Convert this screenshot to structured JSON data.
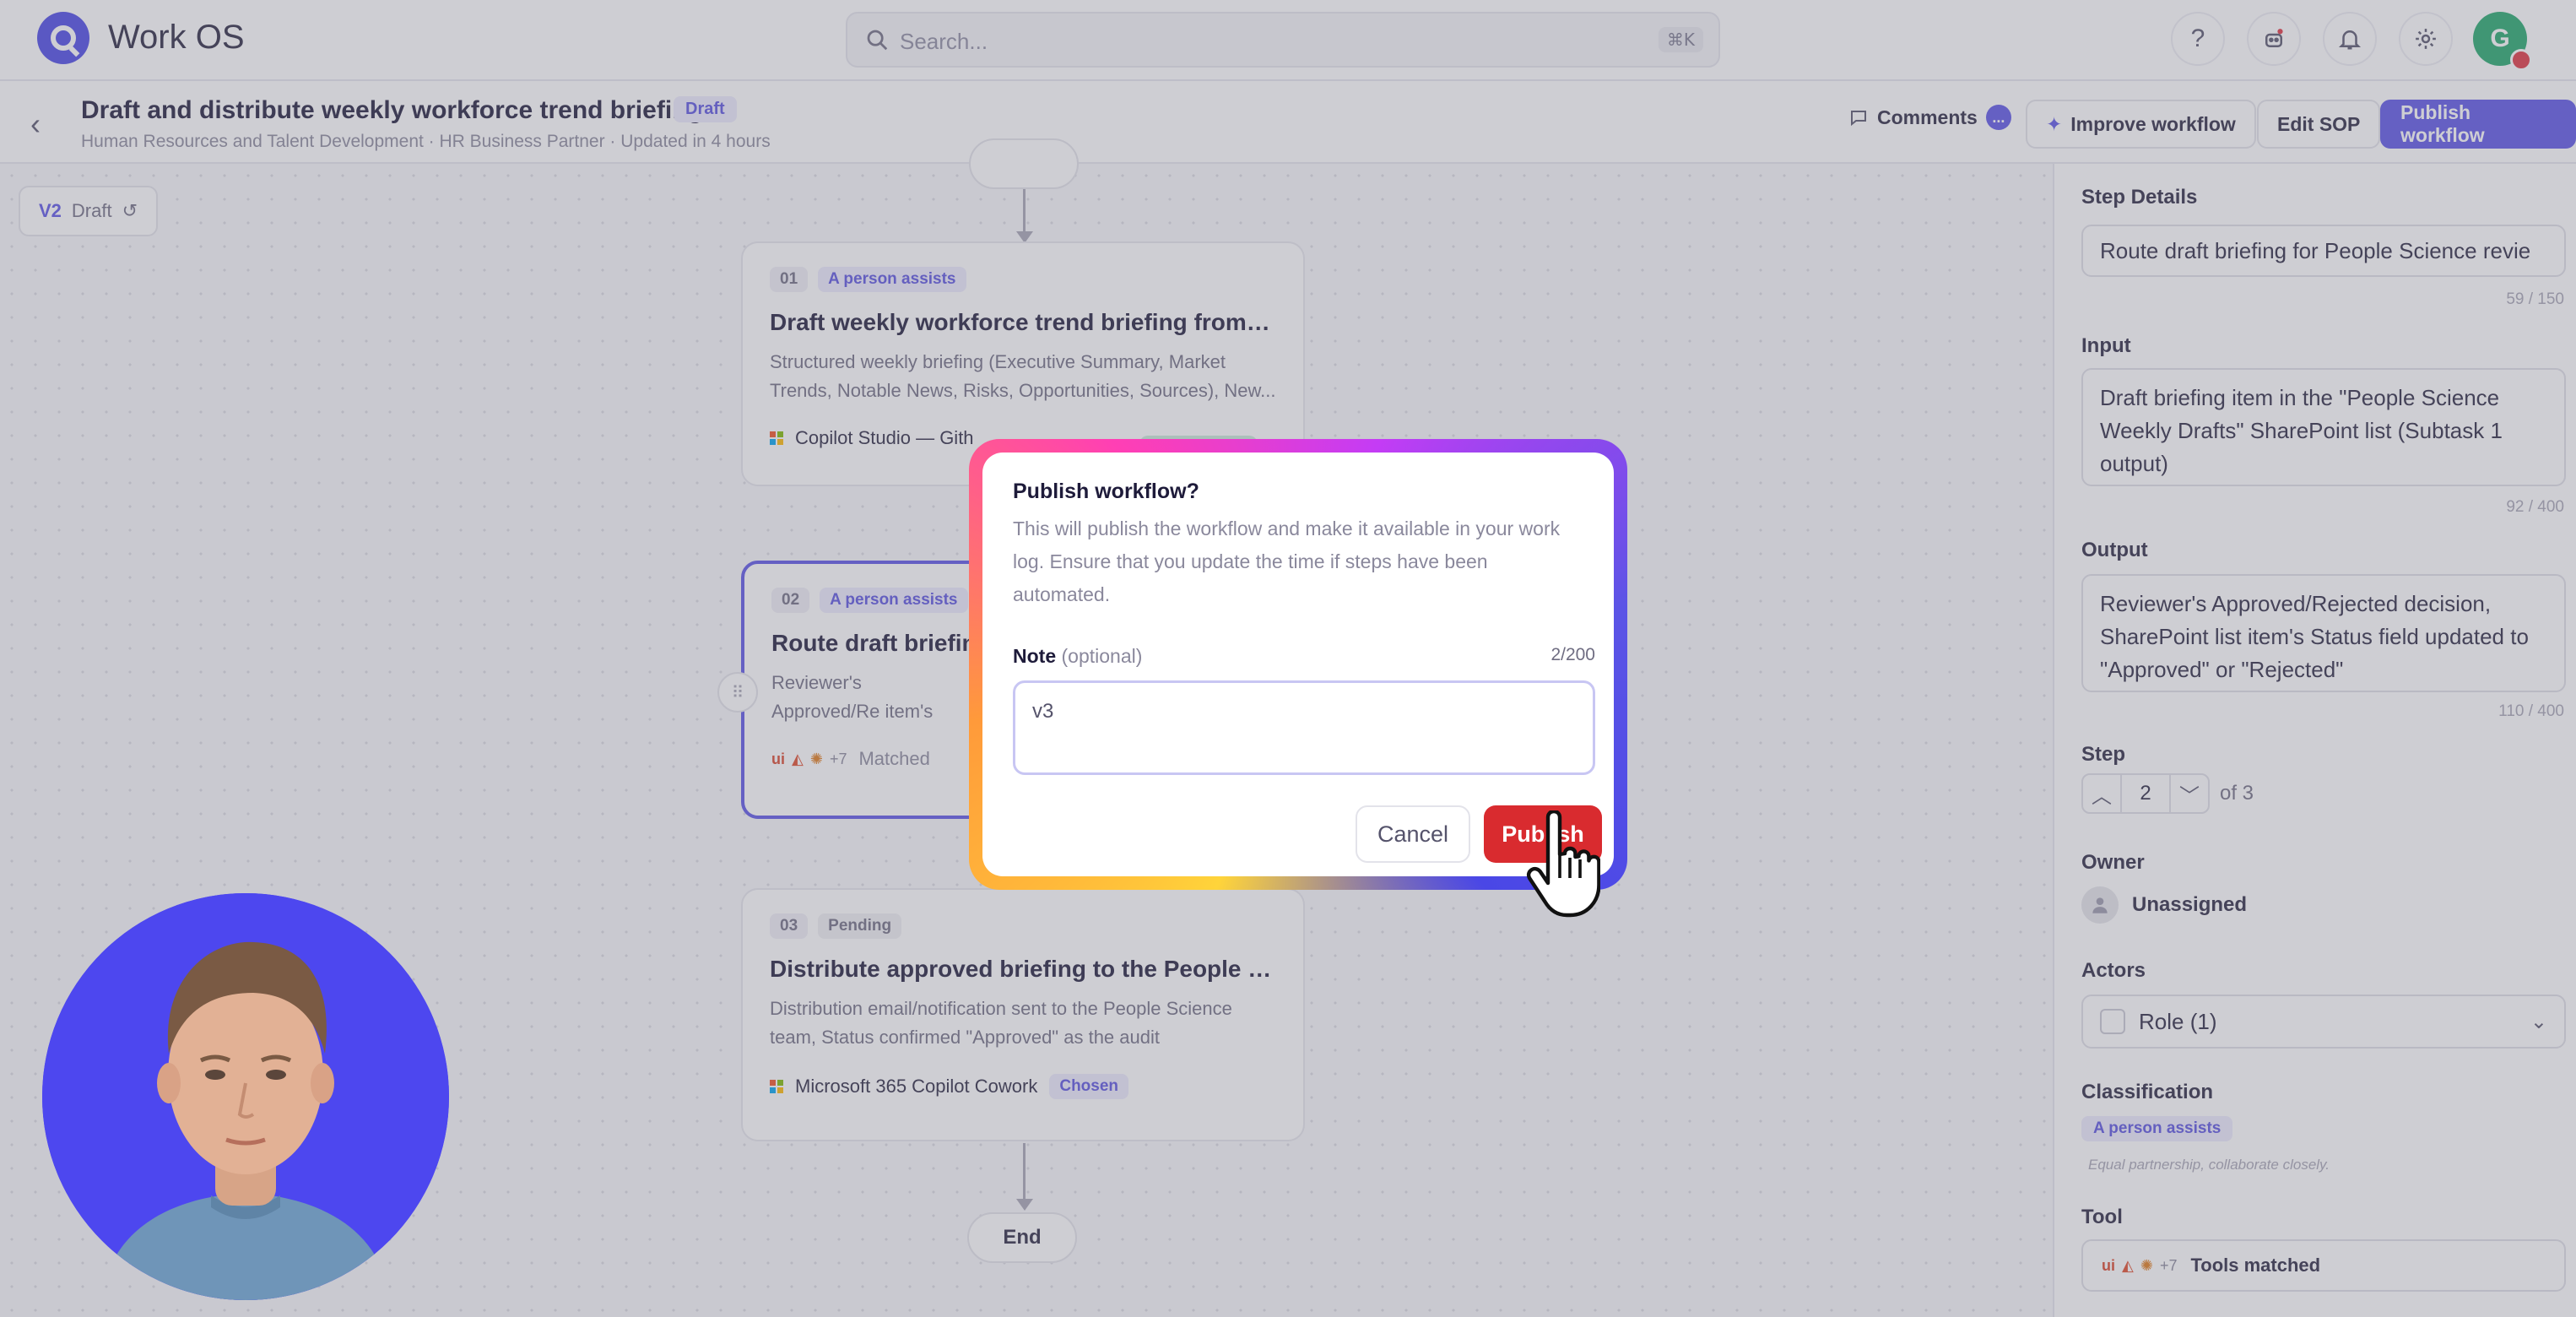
{
  "app": {
    "title": "Work OS"
  },
  "search": {
    "placeholder": "Search...",
    "shortcut": "⌘K"
  },
  "colors": {
    "accent": "#5b54e6",
    "danger": "#d92b2f",
    "avatar": "#22a86b"
  },
  "user": {
    "initial": "G"
  },
  "workflow": {
    "title": "Draft and distribute weekly workforce trend briefing",
    "status": "Draft",
    "meta": "Human Resources and Talent Development · HR Business Partner · Updated in 4 hours"
  },
  "header_actions": {
    "comments": "Comments",
    "comments_badge": "...",
    "improve": "Improve workflow",
    "edit_sop": "Edit SOP",
    "publish": "Publish workflow"
  },
  "version": {
    "label": "V2",
    "status": "Draft"
  },
  "steps": [
    {
      "num": "01",
      "tag": "A person assists",
      "title": "Draft weekly workforce trend briefing from app...",
      "desc": "Structured weekly briefing (Executive Summary, Market Trends, Notable News, Risks, Opportunities, Sources), New...",
      "tool": "Copilot Studio — Gith"
    },
    {
      "num": "02",
      "tag": "A person assists",
      "title": "Route draft briefing",
      "desc": "Reviewer's Approved/Re item's Status field updat",
      "tool_more": "+7",
      "tool_status": "Matched"
    },
    {
      "num": "03",
      "tag": "Pending",
      "title": "Distribute approved briefing to the People Scie...",
      "desc": "Distribution email/notification sent to the People Science team, Status confirmed \"Approved\" as the audit",
      "tool": "Microsoft 365 Copilot Cowork",
      "tool_badge": "Chosen"
    }
  ],
  "end_node": "End",
  "panel": {
    "step_details_label": "Step Details",
    "step_details_value": "Route draft briefing for People Science revie",
    "step_details_count": "59 / 150",
    "input_label": "Input",
    "input_value": "Draft briefing item in the \"People Science Weekly Drafts\" SharePoint list (Subtask 1 output)",
    "input_count": "92 / 400",
    "output_label": "Output",
    "output_value": "Reviewer's Approved/Rejected decision, SharePoint list item's Status field updated to \"Approved\" or \"Rejected\"",
    "output_count": "110 / 400",
    "step_label": "Step",
    "step_value": "2",
    "step_of": "of 3",
    "owner_label": "Owner",
    "owner_value": "Unassigned",
    "actors_label": "Actors",
    "actors_value": "Role (1)",
    "classification_label": "Classification",
    "classification_value": "A person assists",
    "classification_note": "Equal partnership, collaborate closely.",
    "tool_label": "Tool",
    "tool_more": "+7",
    "tool_value": "Tools matched"
  },
  "modal": {
    "title": "Publish workflow?",
    "description": "This will publish the workflow and make it available in your work log. Ensure that you update the time if steps have been automated.",
    "note_label": "Note",
    "note_optional": "(optional)",
    "note_count": "2/200",
    "note_value": "v3",
    "cancel": "Cancel",
    "publish": "Publish"
  }
}
